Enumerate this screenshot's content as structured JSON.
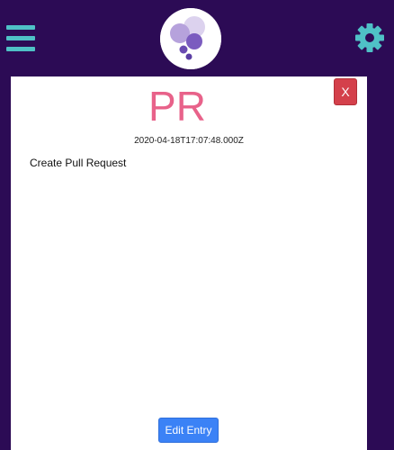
{
  "header": {
    "menu_icon": "hamburger-menu-icon",
    "logo_icon": "bubbles-logo-icon",
    "settings_icon": "gear-icon"
  },
  "entry": {
    "title": "PR",
    "timestamp": "2020-04-18T17:07:48.000Z",
    "body": "Create Pull Request",
    "close_label": "X",
    "edit_label": "Edit Entry"
  },
  "colors": {
    "background": "#2c0b55",
    "menu_accent": "#4fc1c6",
    "title": "#e8628a",
    "close_button": "#d4404b",
    "edit_button": "#3b82f6"
  }
}
